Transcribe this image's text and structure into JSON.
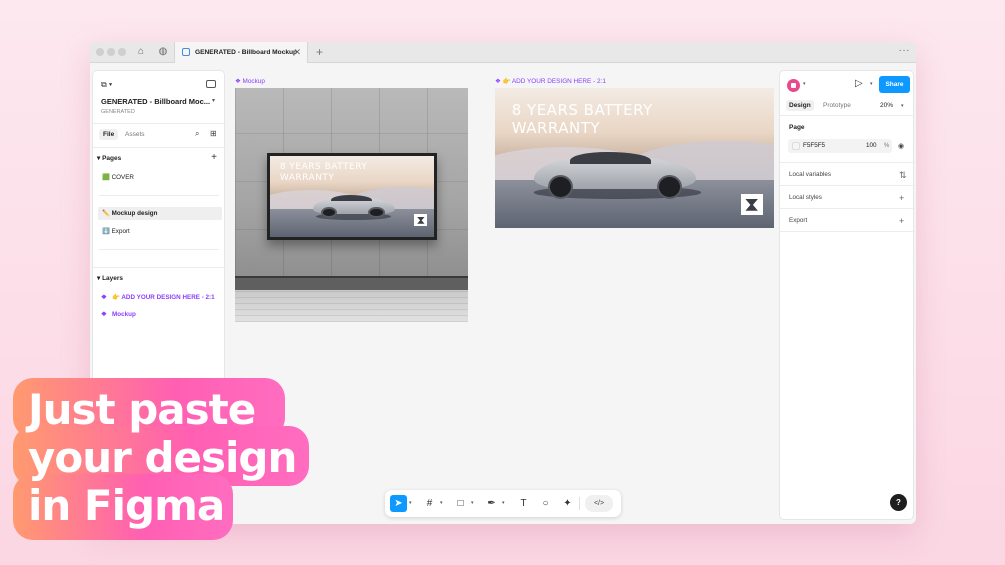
{
  "app": {
    "tab_title": "GENERATED - Billboard Mockup",
    "tab_close": "✕",
    "new_tab": "+",
    "more": "···"
  },
  "left_panel": {
    "file_title": "GENERATED - Billboard Moc...",
    "file_subtitle": "GENERATED",
    "tabs": {
      "file": "File",
      "assets": "Assets"
    },
    "pages_header": "Pages",
    "pages": [
      {
        "label": "🟩 COVER"
      },
      {
        "label": "✏️ Mockup design"
      },
      {
        "label": "⬇️ Export"
      }
    ],
    "layers_header": "Layers",
    "layers": [
      {
        "label": "👉 ADD YOUR DESIGN HERE - 2:1"
      },
      {
        "label": "Mockup"
      }
    ]
  },
  "canvas": {
    "mockup_label": "❖ Mockup",
    "design_label": "❖ 👉 ADD YOUR DESIGN HERE - 2:1",
    "ad_headline": "8 YEARS  BATTERY\nWARRANTY"
  },
  "right_panel": {
    "share_label": "Share",
    "tabs": {
      "design": "Design",
      "prototype": "Prototype"
    },
    "zoom": "20%",
    "page_header": "Page",
    "page_color": "F5F5F5",
    "page_opacity": "100",
    "page_opacity_unit": "%",
    "local_variables": "Local variables",
    "local_styles": "Local styles",
    "export": "Export",
    "help": "?"
  },
  "toolbar": {
    "dev_mode": "</>"
  },
  "promo": {
    "text": "Just paste\nyour design\nin Figma"
  },
  "colors": {
    "accent_purple": "#8a3ffc",
    "share_blue": "#0d99ff",
    "promo_gradient_start": "#ff9a6f",
    "promo_gradient_end": "#ff5fb2"
  },
  "icons": [
    "home-icon",
    "globe-icon",
    "figma-menu-icon",
    "sidebar-toggle-icon",
    "search-icon",
    "library-icon",
    "plus-icon",
    "eye-icon",
    "adjust-icon",
    "play-icon",
    "move-tool-icon",
    "frame-tool-icon",
    "shape-tool-icon",
    "pen-tool-icon",
    "text-tool-icon",
    "comment-tool-icon",
    "ai-tool-icon",
    "dev-mode-icon",
    "help-icon"
  ]
}
